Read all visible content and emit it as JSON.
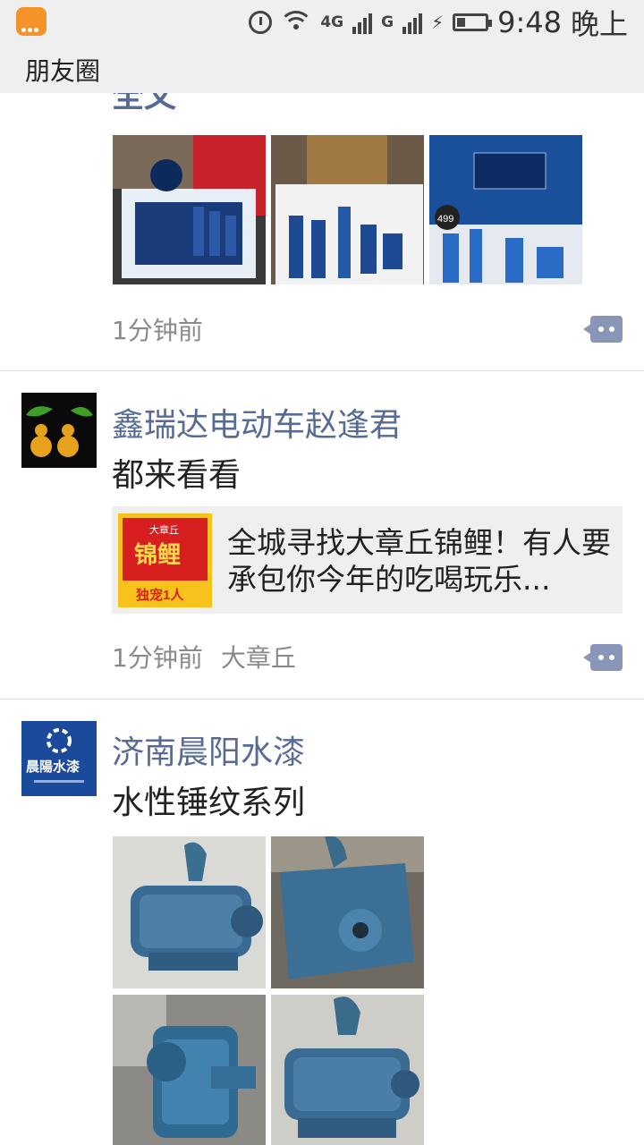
{
  "status_bar": {
    "network": "4G",
    "network2": "G",
    "time": "9:48",
    "period": "晚上"
  },
  "title_bar": {
    "title": "朋友圈"
  },
  "posts": [
    {
      "cut_text": "全文",
      "time": "1分钟前",
      "photos": [
        "cosmetics-gift-box-photo-1",
        "cosmetics-gift-box-photo-2",
        "cosmetics-gift-box-photo-3"
      ],
      "photo_badge": "499"
    },
    {
      "name": "鑫瑞达电动车赵逢君",
      "text": "都来看看",
      "link": {
        "title": "全城寻找大章丘锦鲤！有人要承包你今年的吃喝玩乐...",
        "thumb_caption_top": "大章丘",
        "thumb_caption_main": "锦鲤",
        "thumb_caption_bottom": "独宠1人"
      },
      "time": "1分钟前",
      "location": "大章丘"
    },
    {
      "name": "济南晨阳水漆",
      "avatar_text": "晨陽水漆",
      "text": "水性锤纹系列",
      "photos": [
        "blue-pump-photo-1",
        "blue-pump-photo-2",
        "blue-pump-photo-3",
        "blue-pump-photo-4"
      ]
    }
  ]
}
